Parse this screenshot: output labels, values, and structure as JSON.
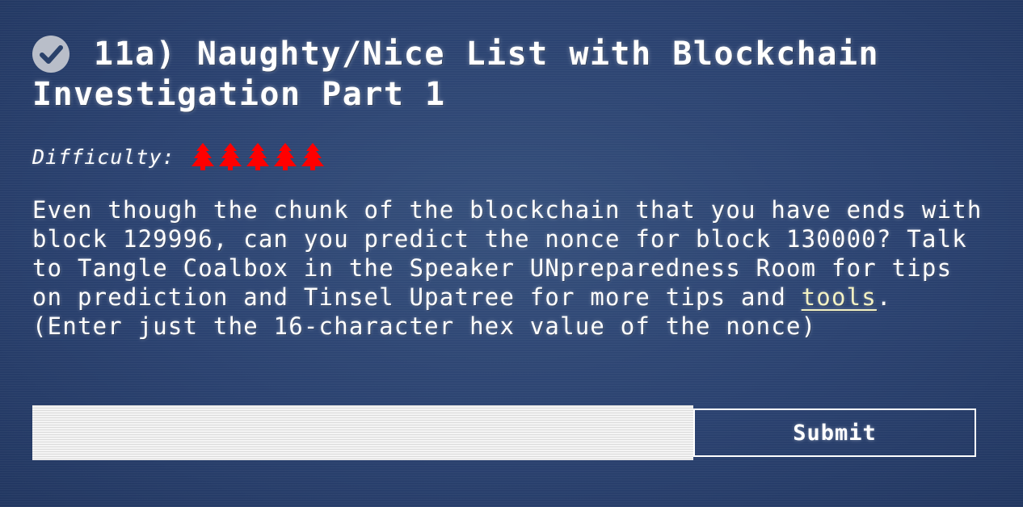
{
  "objective": {
    "completed": true,
    "status_icon": "check-circle-icon",
    "title": "11a) Naughty/Nice List with Blockchain Investigation Part 1",
    "difficulty_label": "Difficulty:",
    "difficulty_level": 5,
    "difficulty_max": 5,
    "difficulty_icon": "tree-icon",
    "difficulty_color": "#ff0000",
    "description_before_link": "Even though the chunk of the blockchain that you have ends with block 129996, can you predict the nonce for block 130000? Talk to Tangle Coalbox in the Speaker UNpreparedness Room for tips on prediction and Tinsel Upatree for more tips and ",
    "description_link": "tools",
    "description_after_link": ". (Enter just the 16-character hex value of the nonce)"
  },
  "answer": {
    "value": "",
    "placeholder": "",
    "submit_label": "Submit"
  },
  "colors": {
    "background": "#2a416a",
    "link": "#f3f2c4",
    "check_circle": "#b9bec9"
  }
}
